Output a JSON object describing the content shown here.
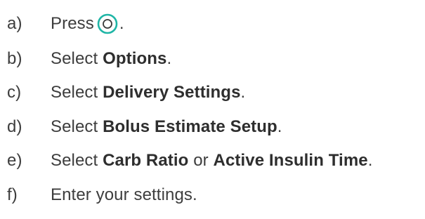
{
  "steps": [
    {
      "marker": "a)",
      "pre": "Press",
      "post": "."
    },
    {
      "marker": "b)",
      "pre": "Select ",
      "bold": "Options",
      "post": "."
    },
    {
      "marker": "c)",
      "pre": "Select ",
      "bold": "Delivery Settings",
      "post": "."
    },
    {
      "marker": "d)",
      "pre": "Select ",
      "bold": "Bolus Estimate Setup",
      "post": "."
    },
    {
      "marker": "e)",
      "pre": "Select ",
      "bold": "Carb Ratio",
      "mid": " or ",
      "bold2": "Active Insulin Time",
      "post": "."
    },
    {
      "marker": "f)",
      "text": "Enter your settings."
    }
  ],
  "icons": {
    "home_button": "home-button-icon",
    "ring_color": "#1fb5a6",
    "inner_color": "#3a3a3a"
  }
}
